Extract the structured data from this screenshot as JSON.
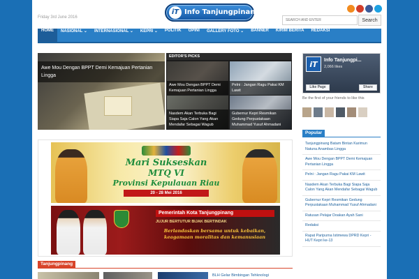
{
  "header": {
    "date": "Friday 3rd June 2016",
    "logo_text": "Info Tanjungpinang",
    "logo_mark": "iT",
    "search_placeholder": "SEARCH AND ENTER",
    "search_button": "Search",
    "social_icons": [
      "rss-icon",
      "google-plus-icon",
      "facebook-icon",
      "twitter-icon"
    ]
  },
  "nav": {
    "items": [
      {
        "label": "HOME",
        "active": true
      },
      {
        "label": "NASIONAL",
        "dropdown": true
      },
      {
        "label": "INTERNASIONAL",
        "dropdown": true
      },
      {
        "label": "KEPRI",
        "dropdown": true
      },
      {
        "label": "POLITIK"
      },
      {
        "label": "OPINI"
      },
      {
        "label": "GALLERY FOTO",
        "dropdown": true
      },
      {
        "label": "BANNER"
      },
      {
        "label": "KIRIM BERITA"
      },
      {
        "label": "REDAKSI"
      }
    ]
  },
  "slider": {
    "caption": "Awe Mou Dengan BPPT Demi Kemajuan Pertanian Lingga"
  },
  "editors_picks": {
    "title": "EDITOR'S PICKS",
    "items": [
      "Awe Mou Dengan BPPT Demi Kemajuan Pertanian Lingga",
      "Pelni : Jangan Ragu Pakai KM Lawit",
      "Nasdem Akan Terbuka Bagi Siapa Saja Calon Yang Akan Mendafar Sebagai Wagub",
      "Gubernur Kepri Resmikan Gedung Perpustakaan Muhammad Yusuf Ahmadani"
    ]
  },
  "banner": {
    "line1": "Mari Sukseskan",
    "line2": "MTQ VI",
    "line3": "Provinsi Kepulauan Riau",
    "dates": "20 - 28 Mei 2016",
    "pemko": "Pemerintah Kota Tanjungpinang",
    "sub": "JUJUR BERTUTUR BIJAK BERTINDAK",
    "motto": "Berlandaskan bersama untuk kebaikan, keagamaan moralitas dan kemanusiaan"
  },
  "section": {
    "title": "Tanjungpinang",
    "teaser": "BLH Gelar Bimbingan Tehknologi"
  },
  "facebook": {
    "name": "Info Tanjungpi...",
    "likes": "2,066 likes",
    "like_label": "Like Page",
    "share_label": "Share",
    "friends_text": "Be the first of your friends to like this"
  },
  "popular": {
    "title": "Popular",
    "items": [
      "Tanjungpinang Batam Bintan Karimun Natuna Anambas Lingga",
      "Awe Mou Dengan BPPT Demi Kemajuan Pertanian Lingga",
      "Pelni : Jangan Ragu Pakai KM Lawit",
      "Nasdem Akan Terbuka Bagi Siapa Saja Calon Yang Akan Mendafar Sebagai Wagub",
      "Gubernur Kepri Resmikan Gedung Perpustakaan Muhammad Yusuf Ahmadani",
      "Ratusan Pelajar Doakan Ayah Sani",
      "Redaksi",
      "Rapat Paripurna Istimewa DPRD Kepri - HUT Kepri ke-13"
    ]
  },
  "colors": {
    "page_bg": "#1a6fb5",
    "nav": "#2a7fc6",
    "accent_red": "#d8442a",
    "link": "#1a5f9c"
  }
}
